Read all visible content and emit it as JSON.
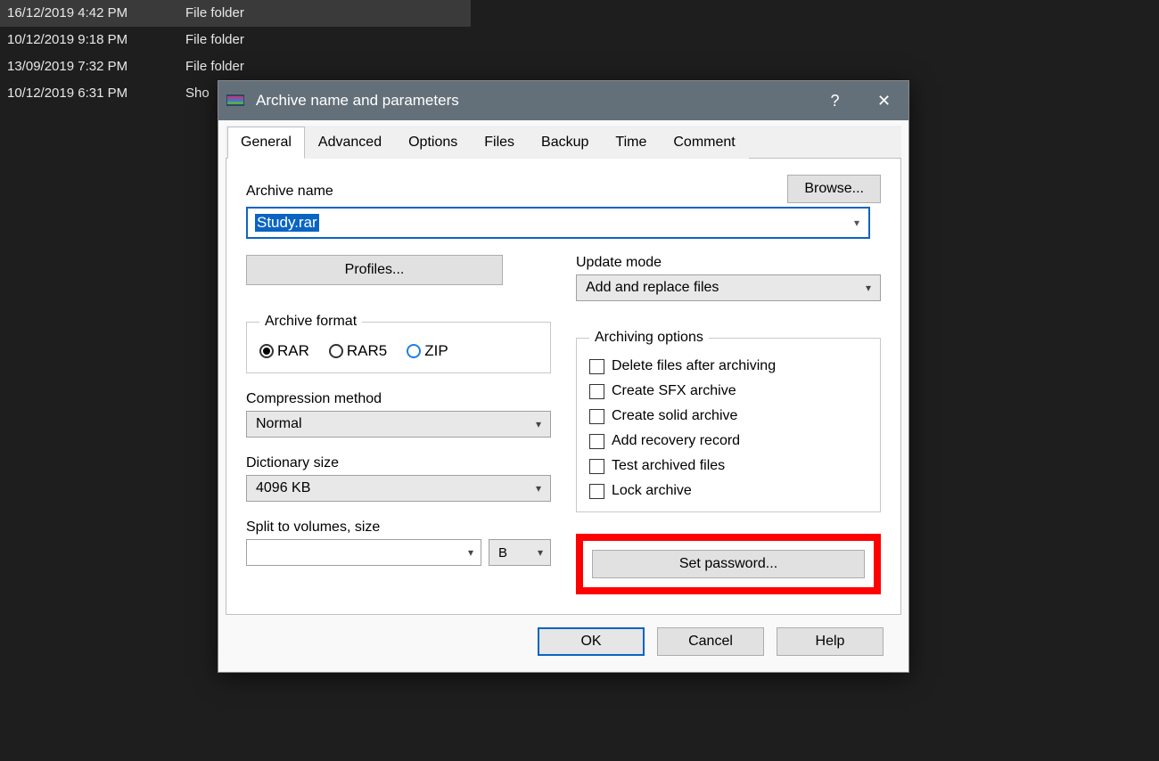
{
  "background_files": [
    {
      "date": "16/12/2019 4:42 PM",
      "type": "File folder",
      "selected": true
    },
    {
      "date": "10/12/2019 9:18 PM",
      "type": "File folder",
      "selected": false
    },
    {
      "date": "13/09/2019 7:32 PM",
      "type": "File folder",
      "selected": false
    },
    {
      "date": "10/12/2019 6:31 PM",
      "type": "Sho",
      "selected": false
    }
  ],
  "dialog": {
    "title": "Archive name and parameters",
    "help_symbol": "?",
    "close_symbol": "✕",
    "tabs": [
      "General",
      "Advanced",
      "Options",
      "Files",
      "Backup",
      "Time",
      "Comment"
    ],
    "active_tab": "General",
    "archive_name_label": "Archive name",
    "browse_button": "Browse...",
    "archive_name_value": "Study.rar",
    "profiles_button": "Profiles...",
    "update_mode_label": "Update mode",
    "update_mode_value": "Add and replace files",
    "archive_format_label": "Archive format",
    "formats": {
      "rar": "RAR",
      "rar5": "RAR5",
      "zip": "ZIP"
    },
    "format_selected": "RAR",
    "compression_method_label": "Compression method",
    "compression_method_value": "Normal",
    "dictionary_size_label": "Dictionary size",
    "dictionary_size_value": "4096 KB",
    "split_label": "Split to volumes, size",
    "split_value": "",
    "split_unit": "B",
    "archiving_options_label": "Archiving options",
    "archiving_options": [
      "Delete files after archiving",
      "Create SFX archive",
      "Create solid archive",
      "Add recovery record",
      "Test archived files",
      "Lock archive"
    ],
    "set_password_button": "Set password...",
    "footer": {
      "ok": "OK",
      "cancel": "Cancel",
      "help": "Help"
    }
  }
}
